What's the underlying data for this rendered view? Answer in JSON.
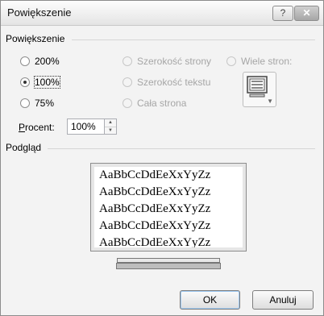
{
  "window": {
    "title": "Powiększenie",
    "help_label": "?",
    "close_label": "✕"
  },
  "zoom_group": {
    "label": "Powiększenie",
    "radio_200": "200%",
    "radio_100": "100%",
    "radio_75": "75%",
    "selected": "100%",
    "page_width": "Szerokość strony",
    "text_width": "Szerokość tekstu",
    "whole_page": "Cała strona",
    "many_pages": "Wiele stron:"
  },
  "percent": {
    "label": "Procent:",
    "value": "100%"
  },
  "preview": {
    "label": "Podgląd",
    "sample_lines": [
      "AaBbCcDdEeXxYyZz",
      "AaBbCcDdEeXxYyZz",
      "AaBbCcDdEeXxYyZz",
      "AaBbCcDdEeXxYyZz",
      "AaBbCcDdEeXxYyZz"
    ]
  },
  "buttons": {
    "ok": "OK",
    "cancel": "Anuluj"
  }
}
